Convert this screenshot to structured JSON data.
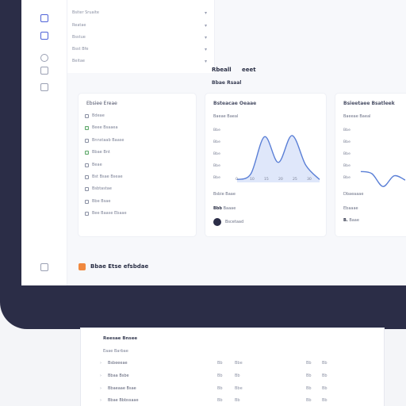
{
  "nav": {
    "items": [
      {
        "label": "Bsiter Sruaite"
      },
      {
        "label": "Reatae"
      },
      {
        "label": "Bsstue"
      },
      {
        "label": "Bsst Bfe"
      },
      {
        "label": "Beitae"
      }
    ]
  },
  "header": {
    "heading_a": "Rbeall",
    "heading_b": "eeet",
    "subheading": "Bbae Rsaal"
  },
  "panel_left": {
    "title": "Ebsiee Ereae",
    "rows": [
      {
        "label": "Bdeae"
      },
      {
        "label": "Beee Bsaaea"
      },
      {
        "label": "Bnnstaab Baase"
      },
      {
        "label": "Bbae Bnt"
      },
      {
        "label": "Beae"
      },
      {
        "label": "Bst Bsae Bseae"
      },
      {
        "label": "Bsbtastae"
      },
      {
        "label": "Bbe Bsae"
      },
      {
        "label": "Bee Baase Ebaae"
      }
    ]
  },
  "panel_mid": {
    "title": "Bsteacae Oeaae",
    "legend_1": "Baeae Baeal",
    "footer_1": "Bsbie Baae",
    "footer_2_badge": "Bbb",
    "footer_2": "Baaae",
    "footer_3": "Bscetaad",
    "x_ticks": [
      "0",
      "10",
      "15",
      "20",
      "25",
      "30"
    ]
  },
  "panel_right": {
    "title": "Bsieetaee Bsatleek",
    "legend_1": "Baeeae Baeal",
    "footer_1": "Dbaeaaae",
    "footer_2": "Ebaaae",
    "footer_3_badge": "B.",
    "footer_3": "Baae"
  },
  "chart_data": [
    {
      "type": "line",
      "y_tick_labels": [
        "Bbe",
        "Bbe",
        "Bbe",
        "Bbe",
        "Bbe"
      ],
      "x": [
        0,
        5,
        10,
        15,
        20,
        25,
        30
      ],
      "series": [
        {
          "values": [
            0.05,
            0.15,
            0.8,
            0.35,
            0.82,
            0.3,
            0.05
          ]
        }
      ],
      "fill": true,
      "color": "#5a7fd6"
    },
    {
      "type": "line",
      "y_tick_labels": [
        "Bbe",
        "Bbe",
        "Bbe",
        "Bbe",
        "Bbe"
      ],
      "x": [
        0,
        5,
        10,
        15,
        20
      ],
      "series": [
        {
          "values": [
            0.55,
            0.5,
            0.2,
            0.45,
            0.35
          ]
        }
      ],
      "fill": false,
      "color": "#5a7fd6"
    }
  ],
  "bottom": {
    "label": "Bbae Etse efsbdae"
  },
  "sheet": {
    "title": "Reesae Bnsee",
    "header": "Eaae Barbae",
    "rows": [
      {
        "name": "Bsbeeeae",
        "c1": "Bb",
        "c2": "Bbe",
        "c3": "Bb",
        "c4": "Bb"
      },
      {
        "name": "Bbaa Bsbe",
        "c1": "Bb",
        "c2": "Bb",
        "c3": "Bb",
        "c4": "Bb"
      },
      {
        "name": "Bbaeaae Bsae",
        "c1": "Bb",
        "c2": "Bbe",
        "c3": "Bb",
        "c4": "Bb"
      },
      {
        "name": "Bbae Bbbssaae",
        "c1": "Bb",
        "c2": "Bb",
        "c3": "Bb",
        "c4": "Bb"
      }
    ]
  },
  "colors": {
    "accent": "#4f63d8",
    "frame": "#2b2d47",
    "orange": "#f0883e"
  }
}
